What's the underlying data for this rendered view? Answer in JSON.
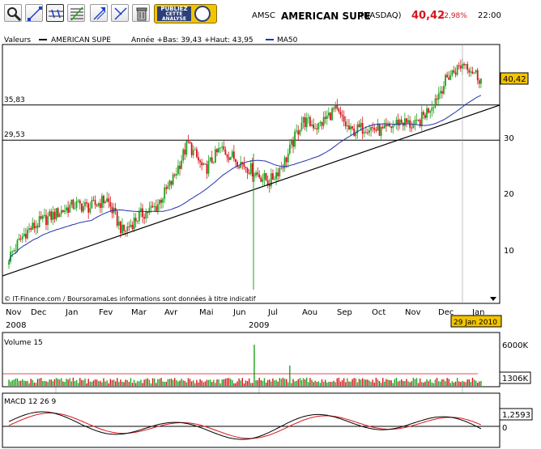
{
  "toolbar": {
    "buttons": [
      "zoom-icon",
      "line-icon",
      "parallel-lines-icon",
      "fibonacci-icon",
      "arrow-up-icon",
      "cross-lines-icon",
      "trash-icon"
    ],
    "promo": {
      "line1": "PUBLIEZ",
      "line2": "CETTE",
      "line3": "ANALYSE"
    }
  },
  "quote": {
    "code": "AMSC",
    "name": "AMERICAN SUPE",
    "market": "(NASDAQ)",
    "price": "40,42",
    "change": "-2,98%",
    "time": "22:00"
  },
  "colors": {
    "up": "#1fa31f",
    "down": "#d8141b",
    "ma": "#2233aa",
    "price_tag": "#f2c400",
    "grid": "#000000"
  },
  "chart_data": [
    {
      "type": "candlestick",
      "legend": {
        "valeurs": "Valeurs",
        "series": "AMERICAN SUPE",
        "stats": "Année +Bas: 39,43 +Haut: 43,95",
        "ma": "MA50"
      },
      "y_ticks": [
        "10",
        "20",
        "30"
      ],
      "ylim": [
        0,
        46
      ],
      "h_lines": [
        {
          "value": 35.83,
          "label": "35,83"
        },
        {
          "value": 29.53,
          "label": "29,53"
        }
      ],
      "trendline": {
        "from": {
          "date": "2008-11-03",
          "value": 5.2
        },
        "to": {
          "date": "2010-01-29",
          "value": 35.8
        }
      },
      "last_price": "40,42",
      "months": [
        "Nov",
        "Dec",
        "Jan",
        "Fev",
        "Mar",
        "Avr",
        "Mai",
        "Jun",
        "Jul",
        "Aou",
        "Sep",
        "Oct",
        "Nov",
        "Dec",
        "Jan"
      ],
      "years": [
        "2008",
        "2009"
      ],
      "current_date": "29 Jan 2010",
      "copyright": "© IT-Finance.com / BoursoramaLes informations sont données à titre indicatif",
      "close_path": [
        [
          "2008-11",
          8.5
        ],
        [
          "2008-11",
          13
        ],
        [
          "2008-12",
          15
        ],
        [
          "2008-12",
          16.5
        ],
        [
          "2009-01",
          18
        ],
        [
          "2009-01",
          17.5
        ],
        [
          "2009-02",
          19
        ],
        [
          "2009-02",
          13
        ],
        [
          "2009-03",
          16
        ],
        [
          "2009-03",
          17.5
        ],
        [
          "2009-04",
          22
        ],
        [
          "2009-04",
          29
        ],
        [
          "2009-05",
          24
        ],
        [
          "2009-05",
          28
        ],
        [
          "2009-06",
          26
        ],
        [
          "2009-06",
          24
        ],
        [
          "2009-07",
          22
        ],
        [
          "2009-07",
          26
        ],
        [
          "2009-08",
          33
        ],
        [
          "2009-08",
          32
        ],
        [
          "2009-09",
          35
        ],
        [
          "2009-09",
          31
        ],
        [
          "2009-10",
          32
        ],
        [
          "2009-10",
          31
        ],
        [
          "2009-11",
          33
        ],
        [
          "2009-11",
          32
        ],
        [
          "2009-12",
          36
        ],
        [
          "2009-12",
          41
        ],
        [
          "2010-01",
          43.5
        ],
        [
          "2010-01",
          40.42
        ]
      ]
    },
    {
      "type": "bar",
      "title": "Volume 15",
      "y_ticks": [
        "6000K"
      ],
      "last_value": "1306K",
      "ylim": [
        0,
        6000
      ]
    },
    {
      "type": "line",
      "title": "MACD 12 26 9",
      "y_ticks": [
        "0"
      ],
      "last_value": "1,2593",
      "ylim": [
        -2.5,
        2.5
      ]
    }
  ]
}
